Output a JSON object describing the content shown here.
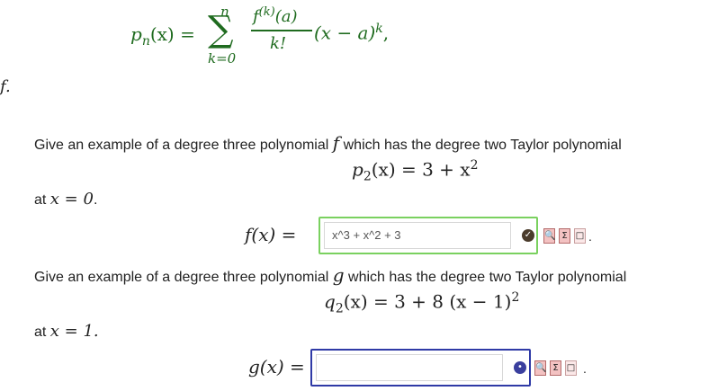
{
  "formula": {
    "lhs": "p",
    "lhs_sub": "n",
    "lhs_arg": "(x) =",
    "sigma": "∑",
    "sum_upper": "n",
    "sum_lower": "k=0",
    "frac_num": "f",
    "frac_num_sup": "(k)",
    "frac_num_arg": "(a)",
    "frac_den": "k!",
    "rhs": "(x − a)",
    "rhs_sup": "k",
    "rhs_tail": ","
  },
  "f_dot": "f.",
  "q1": {
    "prompt_pre": "Give an example of a degree three polynomial",
    "prompt_var": "f",
    "prompt_post": "which has the degree two Taylor polynomial",
    "poly_name": "p",
    "poly_sub": "2",
    "poly_rest": "(x) = 3 + x",
    "poly_sup": "2",
    "at_pre": "at",
    "at_expr": "x = 0",
    "at_post": ".",
    "answer_label": "f(x) =",
    "answer_value": "x^3 + x^2 + 3",
    "status_glyph": "✓",
    "tail_dot": "."
  },
  "q2": {
    "prompt_pre": "Give an example of a degree three polynomial",
    "prompt_var": "g",
    "prompt_post": "which has the degree two Taylor polynomial",
    "poly_name": "q",
    "poly_sub": "2",
    "poly_rest": "(x) = 3 + 8 (x − 1)",
    "poly_sup": "2",
    "at_pre": "at",
    "at_expr": "x = 1.",
    "answer_label": "g(x) =",
    "answer_value": "",
    "status_glyph": "•",
    "tail_dot": "."
  },
  "tools": {
    "preview": "🔍",
    "sigma": "Σ",
    "blank": "□"
  },
  "colors": {
    "formula": "#1f6b1f",
    "correct_border": "#7ad15f",
    "active_border": "#2f3aa6"
  }
}
